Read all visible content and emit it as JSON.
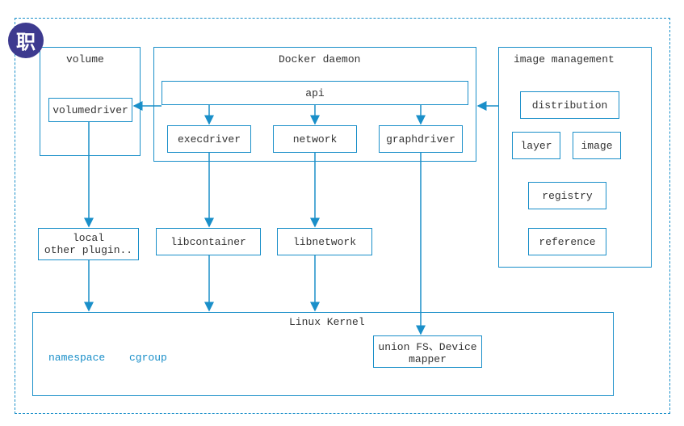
{
  "logo": "职",
  "groups": {
    "volume": {
      "title": "volume"
    },
    "daemon": {
      "title": "Docker daemon"
    },
    "image_mgmt": {
      "title": "image management"
    },
    "kernel": {
      "title": "Linux Kernel"
    }
  },
  "boxes": {
    "volumedriver": "volumedriver",
    "api": "api",
    "execdriver": "execdriver",
    "network": "network",
    "graphdriver": "graphdriver",
    "distribution": "distribution",
    "layer": "layer",
    "image": "image",
    "registry": "registry",
    "reference": "reference",
    "local": "local\nother plugin..",
    "libcontainer": "libcontainer",
    "libnetwork": "libnetwork",
    "unionfs": "union FS、Device\nmapper"
  },
  "kernel_items": {
    "namespace": "namespace",
    "cgroup": "cgroup"
  }
}
